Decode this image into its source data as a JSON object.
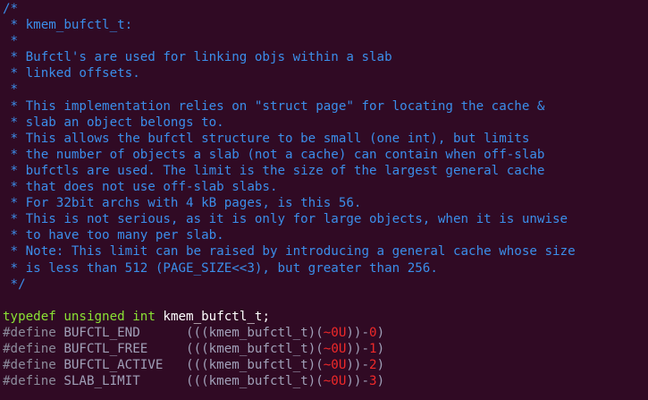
{
  "comment_lines": [
    "/*",
    " * kmem_bufctl_t:",
    " *",
    " * Bufctl's are used for linking objs within a slab",
    " * linked offsets.",
    " *",
    " * This implementation relies on \"struct page\" for locating the cache &",
    " * slab an object belongs to.",
    " * This allows the bufctl structure to be small (one int), but limits",
    " * the number of objects a slab (not a cache) can contain when off-slab",
    " * bufctls are used. The limit is the size of the largest general cache",
    " * that does not use off-slab slabs.",
    " * For 32bit archs with 4 kB pages, is this 56.",
    " * This is not serious, as it is only for large objects, when it is unwise",
    " * to have too many per slab.",
    " * Note: This limit can be raised by introducing a general cache whose size",
    " * is less than 512 (PAGE_SIZE<<3), but greater than 256.",
    " */"
  ],
  "typedef": {
    "kw1": "typedef",
    "kw2": "unsigned",
    "kw3": "int",
    "rest": "kmem_bufctl_t;"
  },
  "defines": [
    {
      "directive": "#define",
      "name": "BUFCTL_END",
      "expr_a": "(((kmem_bufctl_t)(",
      "tilde": "~0U",
      "expr_b": "))-",
      "num": "0",
      "close": ")"
    },
    {
      "directive": "#define",
      "name": "BUFCTL_FREE",
      "expr_a": "(((kmem_bufctl_t)(",
      "tilde": "~0U",
      "expr_b": "))-",
      "num": "1",
      "close": ")"
    },
    {
      "directive": "#define",
      "name": "BUFCTL_ACTIVE",
      "expr_a": "(((kmem_bufctl_t)(",
      "tilde": "~0U",
      "expr_b": "))-",
      "num": "2",
      "close": ")"
    },
    {
      "directive": "#define",
      "name": "SLAB_LIMIT",
      "expr_a": "(((kmem_bufctl_t)(",
      "tilde": "~0U",
      "expr_b": "))-",
      "num": "3",
      "close": ")"
    }
  ],
  "colors": {
    "background": "#300a24",
    "comment": "#3b8eea",
    "type_keyword": "#8ae234",
    "preprocessor": "#8c8c9c",
    "number": "#ef2929",
    "text": "#ffffff"
  }
}
